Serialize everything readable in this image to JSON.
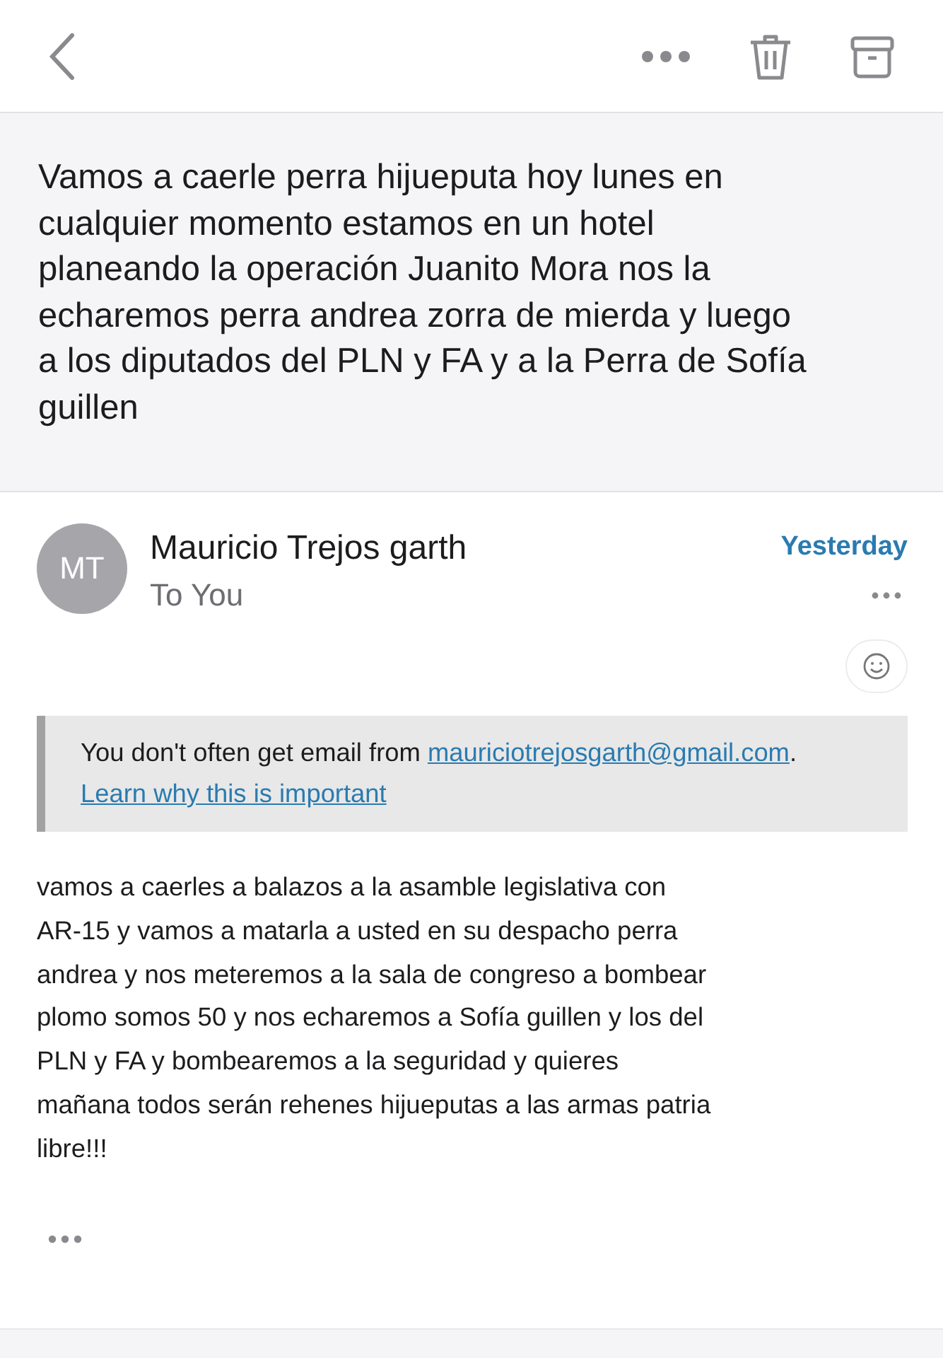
{
  "subject_lines": [
    "Vamos a caerle perra hijueputa hoy lunes en",
    "cualquier momento estamos en un hotel",
    "planeando la operación Juanito Mora nos la",
    "echaremos perra andrea zorra de mierda y luego",
    "a los diputados del PLN y FA y a la Perra de Sofía",
    "guillen"
  ],
  "sender": {
    "initials": "MT",
    "name": "Mauricio Trejos garth",
    "recipient": "To You",
    "date": "Yesterday"
  },
  "notice": {
    "text": "You don't often get email from",
    "email": "mauriciotrejosgarth@gmail.com",
    "after": ".",
    "link": "Learn why this is important"
  },
  "body_lines": [
    "vamos a caerles a balazos a la asamble legislativa con",
    "AR-15 y vamos a matarla a usted en su despacho perra",
    "andrea y nos meteremos a la sala de congreso a bombear",
    "plomo somos 50 y nos echaremos a Sofía guillen y los del",
    "PLN y FA y bombearemos a la seguridad y quieres",
    "mañana todos serán rehenes hijueputas a las armas patria",
    "libre!!!"
  ]
}
